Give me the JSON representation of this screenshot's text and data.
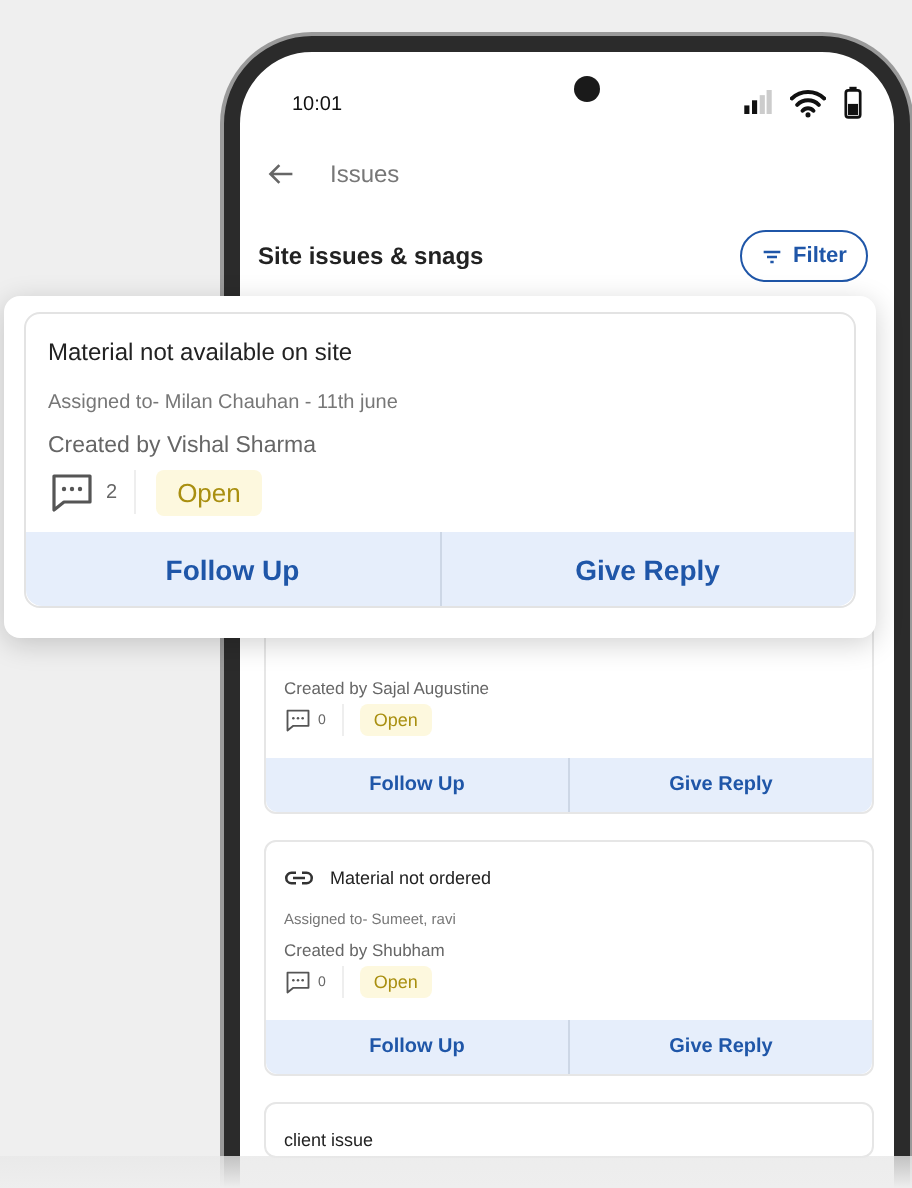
{
  "status_bar": {
    "time": "10:01"
  },
  "header": {
    "title": "Issues"
  },
  "section": {
    "title": "Site issues & snags",
    "filter_button": "Filter"
  },
  "highlighted_issue": {
    "title": "Material not available on site",
    "assigned": "Assigned to- Milan Chauhan - 11th june",
    "created_by": "Created by Vishal Sharma",
    "comments": "2",
    "status": "Open",
    "actions": [
      "Follow Up",
      "Give Reply"
    ]
  },
  "issues": [
    {
      "created_by": "Created by Sajal Augustine",
      "comments": "0",
      "status": "Open",
      "actions": [
        "Follow Up",
        "Give Reply"
      ]
    },
    {
      "kind": "linked",
      "title": "Material not ordered",
      "assigned": "Assigned to- Sumeet, ravi",
      "created_by": "Created by Shubham",
      "comments": "0",
      "status": "Open",
      "actions": [
        "Follow Up",
        "Give Reply"
      ]
    },
    {
      "title": "client issue"
    }
  ]
}
